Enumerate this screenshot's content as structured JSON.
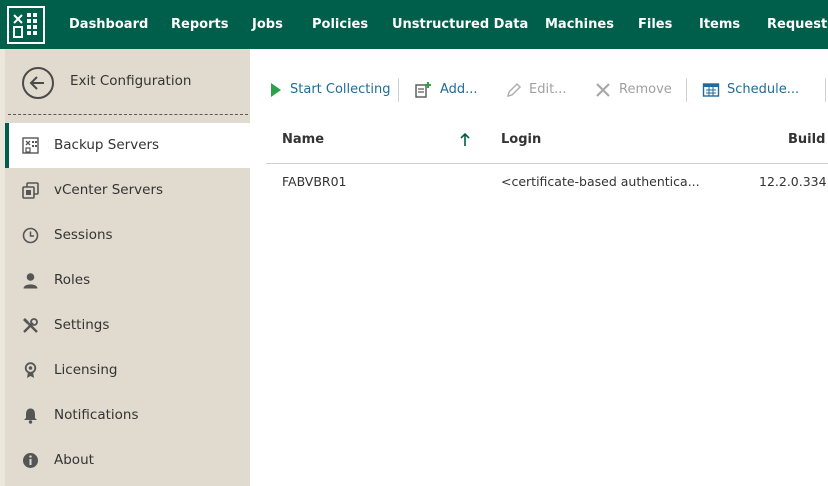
{
  "nav": {
    "items": [
      {
        "label": "Dashboard"
      },
      {
        "label": "Reports"
      },
      {
        "label": "Jobs"
      },
      {
        "label": "Policies"
      },
      {
        "label": "Unstructured Data"
      },
      {
        "label": "Machines"
      },
      {
        "label": "Files"
      },
      {
        "label": "Items"
      },
      {
        "label": "Requests"
      }
    ]
  },
  "sidebar": {
    "exit_label": "Exit Configuration",
    "items": [
      {
        "label": "Backup Servers",
        "icon": "backup-servers-icon",
        "active": true
      },
      {
        "label": "vCenter Servers",
        "icon": "vcenter-icon"
      },
      {
        "label": "Sessions",
        "icon": "clock-icon"
      },
      {
        "label": "Roles",
        "icon": "user-icon"
      },
      {
        "label": "Settings",
        "icon": "tools-icon"
      },
      {
        "label": "Licensing",
        "icon": "license-icon"
      },
      {
        "label": "Notifications",
        "icon": "bell-icon"
      },
      {
        "label": "About",
        "icon": "info-icon"
      }
    ]
  },
  "toolbar": {
    "start_collecting": "Start Collecting",
    "add": "Add...",
    "edit": "Edit...",
    "remove": "Remove",
    "schedule": "Schedule..."
  },
  "table": {
    "columns": [
      "Name",
      "Login",
      "Build"
    ],
    "sort_column": "Name",
    "sort_direction": "ascending",
    "rows": [
      {
        "name": "FABVBR01",
        "login": "<certificate-based authentica...",
        "build": "12.2.0.334"
      }
    ]
  },
  "colors": {
    "brand_green": "#005f4b",
    "sidebar_bg": "#e1dbcf",
    "link_blue": "#1f6b9a",
    "play_green": "#2aa14a"
  }
}
